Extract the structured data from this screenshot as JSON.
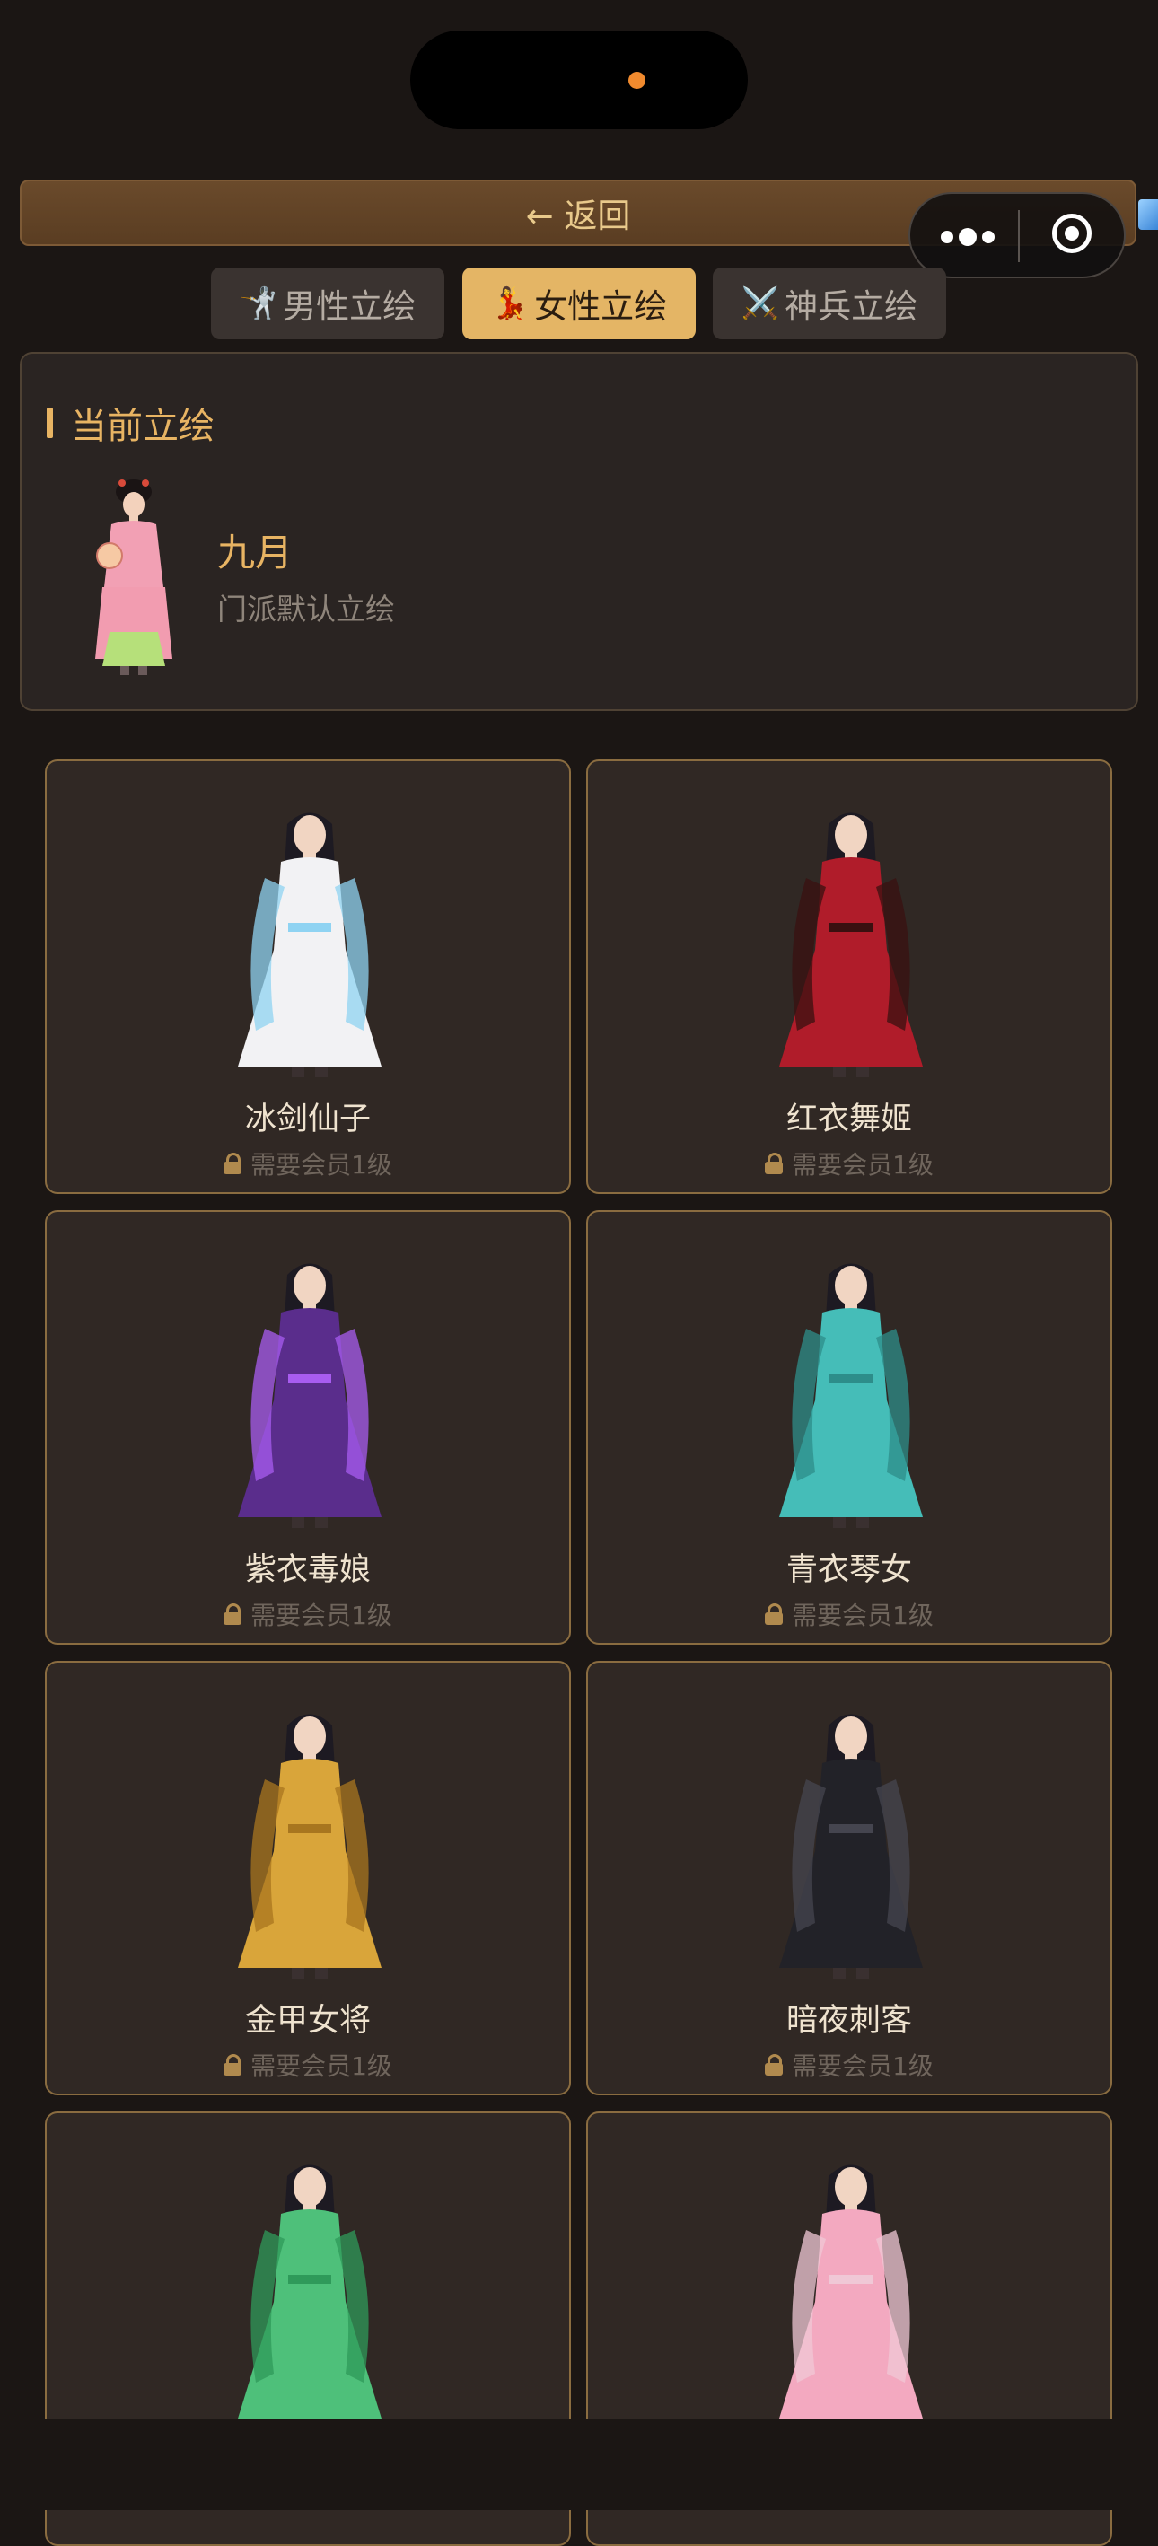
{
  "header": {
    "back_label": "← 返回"
  },
  "tabs": [
    {
      "icon": "🤺",
      "label": "男性立绘",
      "active": false
    },
    {
      "icon": "💃",
      "label": "女性立绘",
      "active": true
    },
    {
      "icon": "⚔️",
      "label": "神兵立绘",
      "active": false
    }
  ],
  "current": {
    "section_title": "当前立绘",
    "name": "九月",
    "desc": "门派默认立绘"
  },
  "cards": [
    {
      "name": "冰剑仙子",
      "lock_text": "需要会员1级",
      "robe": "#f2f2f4",
      "accent": "#8fd3f2"
    },
    {
      "name": "红衣舞姬",
      "lock_text": "需要会员1级",
      "robe": "#b01c2a",
      "accent": "#3a1010"
    },
    {
      "name": "紫衣毒娘",
      "lock_text": "需要会员1级",
      "robe": "#5a2d8c",
      "accent": "#a85cf0"
    },
    {
      "name": "青衣琴女",
      "lock_text": "需要会员1级",
      "robe": "#45bdb8",
      "accent": "#2d8d8a"
    },
    {
      "name": "金甲女将",
      "lock_text": "需要会员1级",
      "robe": "#d9a53a",
      "accent": "#a8761f"
    },
    {
      "name": "暗夜刺客",
      "lock_text": "需要会员1级",
      "robe": "#222228",
      "accent": "#45454f"
    },
    {
      "name": "",
      "lock_text": "",
      "robe": "#4ec07a",
      "accent": "#2f9a5a"
    },
    {
      "name": "",
      "lock_text": "",
      "robe": "#f3a9c0",
      "accent": "#f0c8d6"
    }
  ],
  "colors": {
    "accent_gold": "#e8b463",
    "active_tab": "#e4b565",
    "card_border": "#8a6c40"
  }
}
